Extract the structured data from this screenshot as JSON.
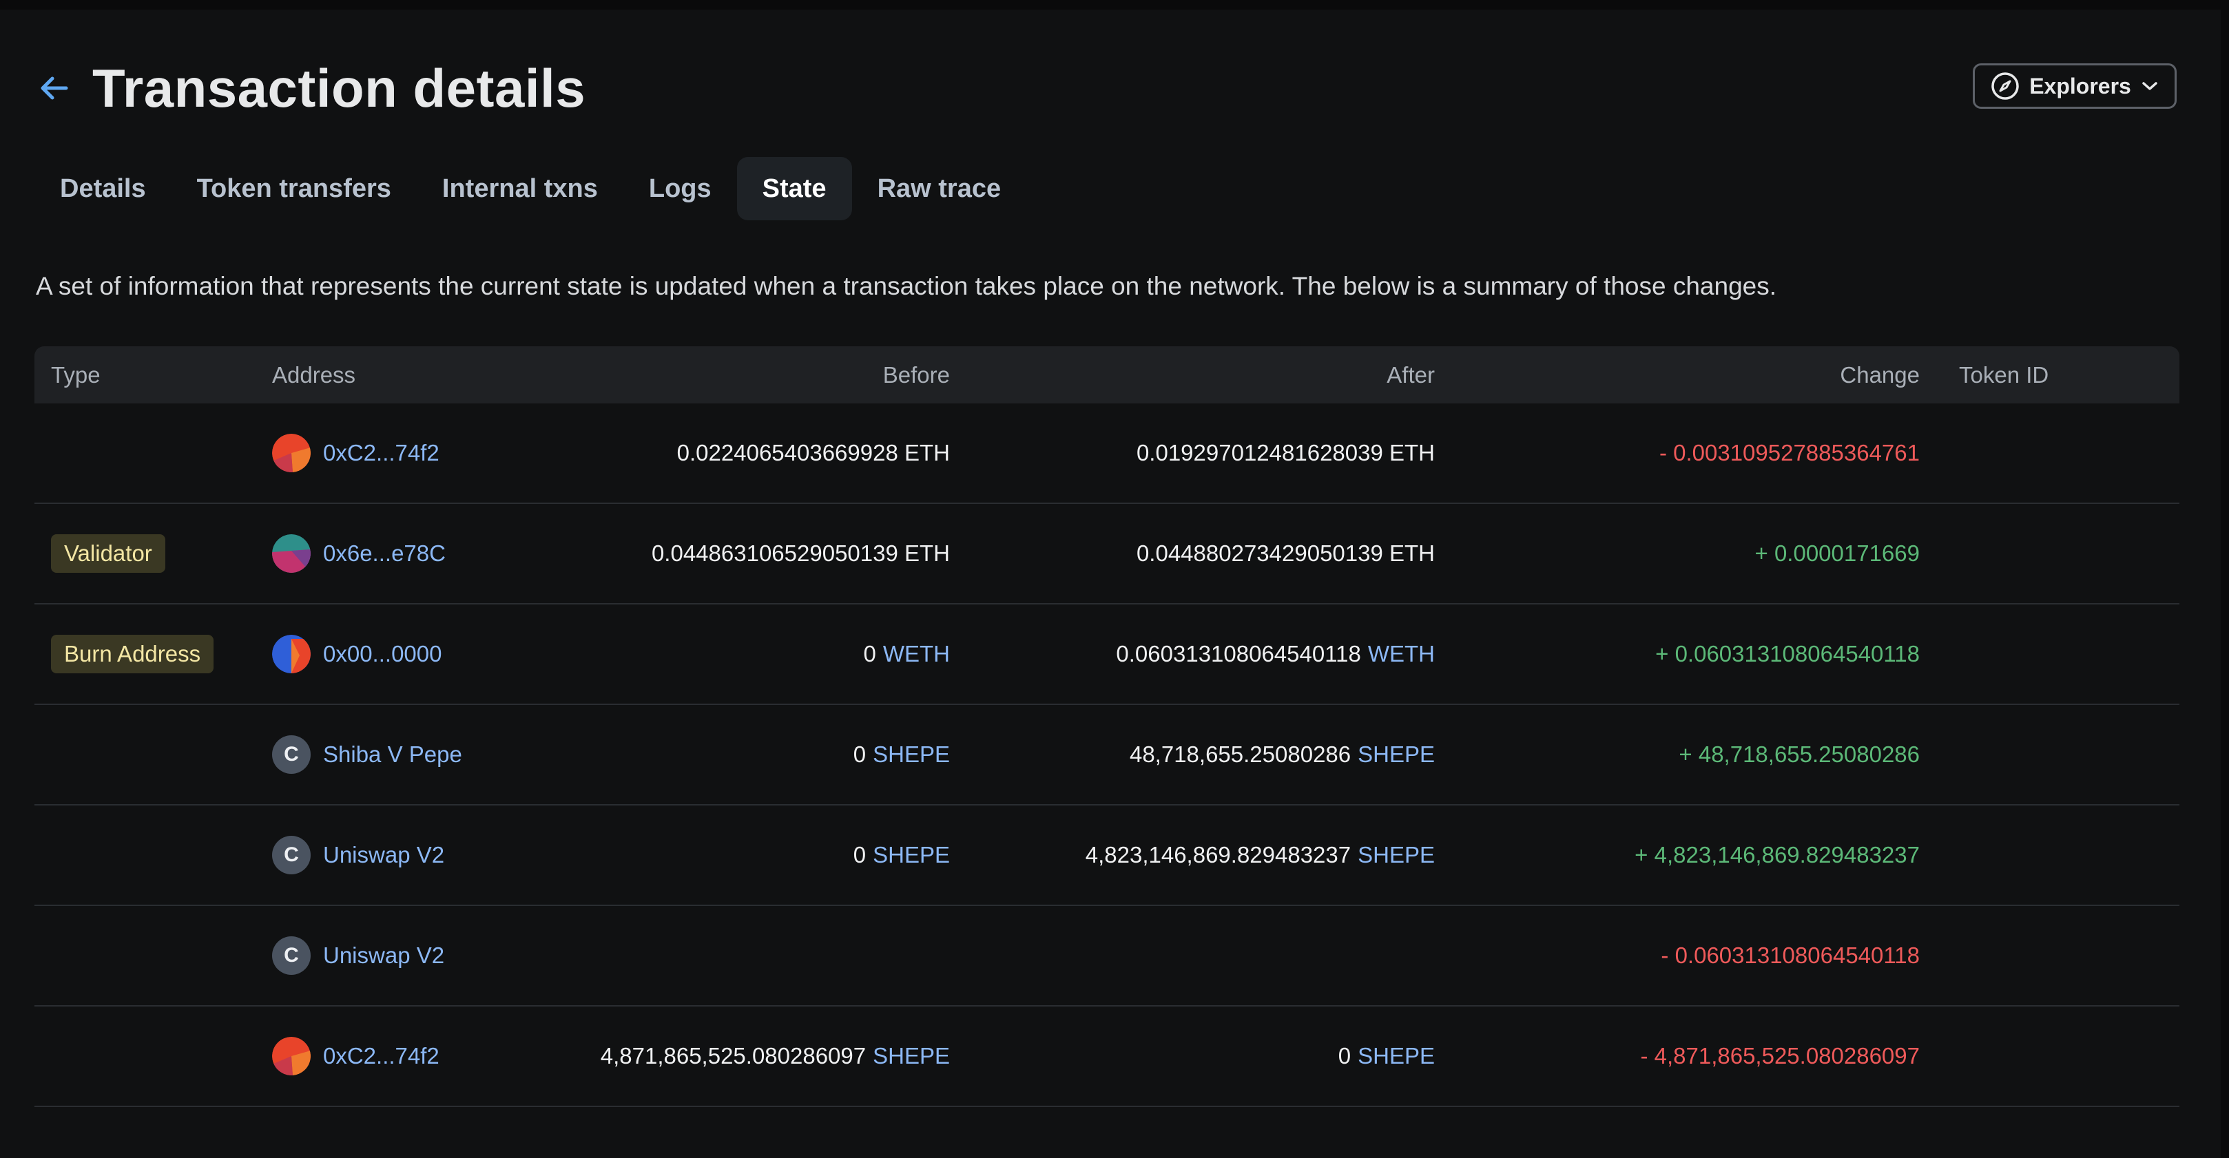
{
  "header": {
    "title": "Transaction details",
    "explorers_label": "Explorers"
  },
  "tabs": [
    {
      "label": "Details"
    },
    {
      "label": "Token transfers"
    },
    {
      "label": "Internal txns"
    },
    {
      "label": "Logs"
    },
    {
      "label": "State",
      "active": true
    },
    {
      "label": "Raw trace"
    }
  ],
  "description": "A set of information that represents the current state is updated when a transaction takes place on the network. The below is a summary of those changes.",
  "table": {
    "columns": {
      "type": "Type",
      "address": "Address",
      "before": "Before",
      "after": "After",
      "change": "Change",
      "token_id": "Token ID"
    },
    "rows": [
      {
        "type": "",
        "address": "0xC2...74f2",
        "avatar": "red-identicon",
        "before": "0.0224065403669928 ETH",
        "before_token": "",
        "after": "0.019297012481628039 ETH",
        "after_token": "",
        "change": "- 0.003109527885364761",
        "change_sign": "negative"
      },
      {
        "type": "Validator",
        "address": "0x6e...e78C",
        "avatar": "teal-pink-identicon",
        "before": "0.044863106529050139 ETH",
        "before_token": "",
        "after": "0.044880273429050139 ETH",
        "after_token": "",
        "change": "+ 0.0000171669",
        "change_sign": "positive"
      },
      {
        "type": "Burn Address",
        "address": "0x00...0000",
        "avatar": "blue-red-identicon",
        "before": "0",
        "before_token": "WETH",
        "after": "0.060313108064540118",
        "after_token": "WETH",
        "change": "+ 0.060313108064540118",
        "change_sign": "positive"
      },
      {
        "type": "",
        "address": "Shiba V Pepe",
        "avatar": "contract-icon",
        "avatar_letter": "C",
        "before": "0",
        "before_token": "SHEPE",
        "after": "48,718,655.25080286",
        "after_token": "SHEPE",
        "change": "+ 48,718,655.25080286",
        "change_sign": "positive"
      },
      {
        "type": "",
        "address": "Uniswap V2",
        "avatar": "contract-icon",
        "avatar_letter": "C",
        "before": "0",
        "before_token": "SHEPE",
        "after": "4,823,146,869.829483237",
        "after_token": "SHEPE",
        "change": "+ 4,823,146,869.829483237",
        "change_sign": "positive"
      },
      {
        "type": "",
        "address": "Uniswap V2",
        "avatar": "contract-icon",
        "avatar_letter": "C",
        "before": "",
        "before_token": "",
        "after": "",
        "after_token": "",
        "change": "- 0.060313108064540118",
        "change_sign": "negative"
      },
      {
        "type": "",
        "address": "0xC2...74f2",
        "avatar": "red-identicon",
        "before": "4,871,865,525.080286097",
        "before_token": "SHEPE",
        "after": "0",
        "after_token": "SHEPE",
        "change": "- 4,871,865,525.080286097",
        "change_sign": "negative"
      }
    ]
  },
  "colors": {
    "background": "#101112",
    "link": "#8cb8f5",
    "negative": "#ef5a5a",
    "positive": "#5cb978",
    "badge_bg": "#3a3823",
    "badge_text": "#f3e6a4"
  }
}
